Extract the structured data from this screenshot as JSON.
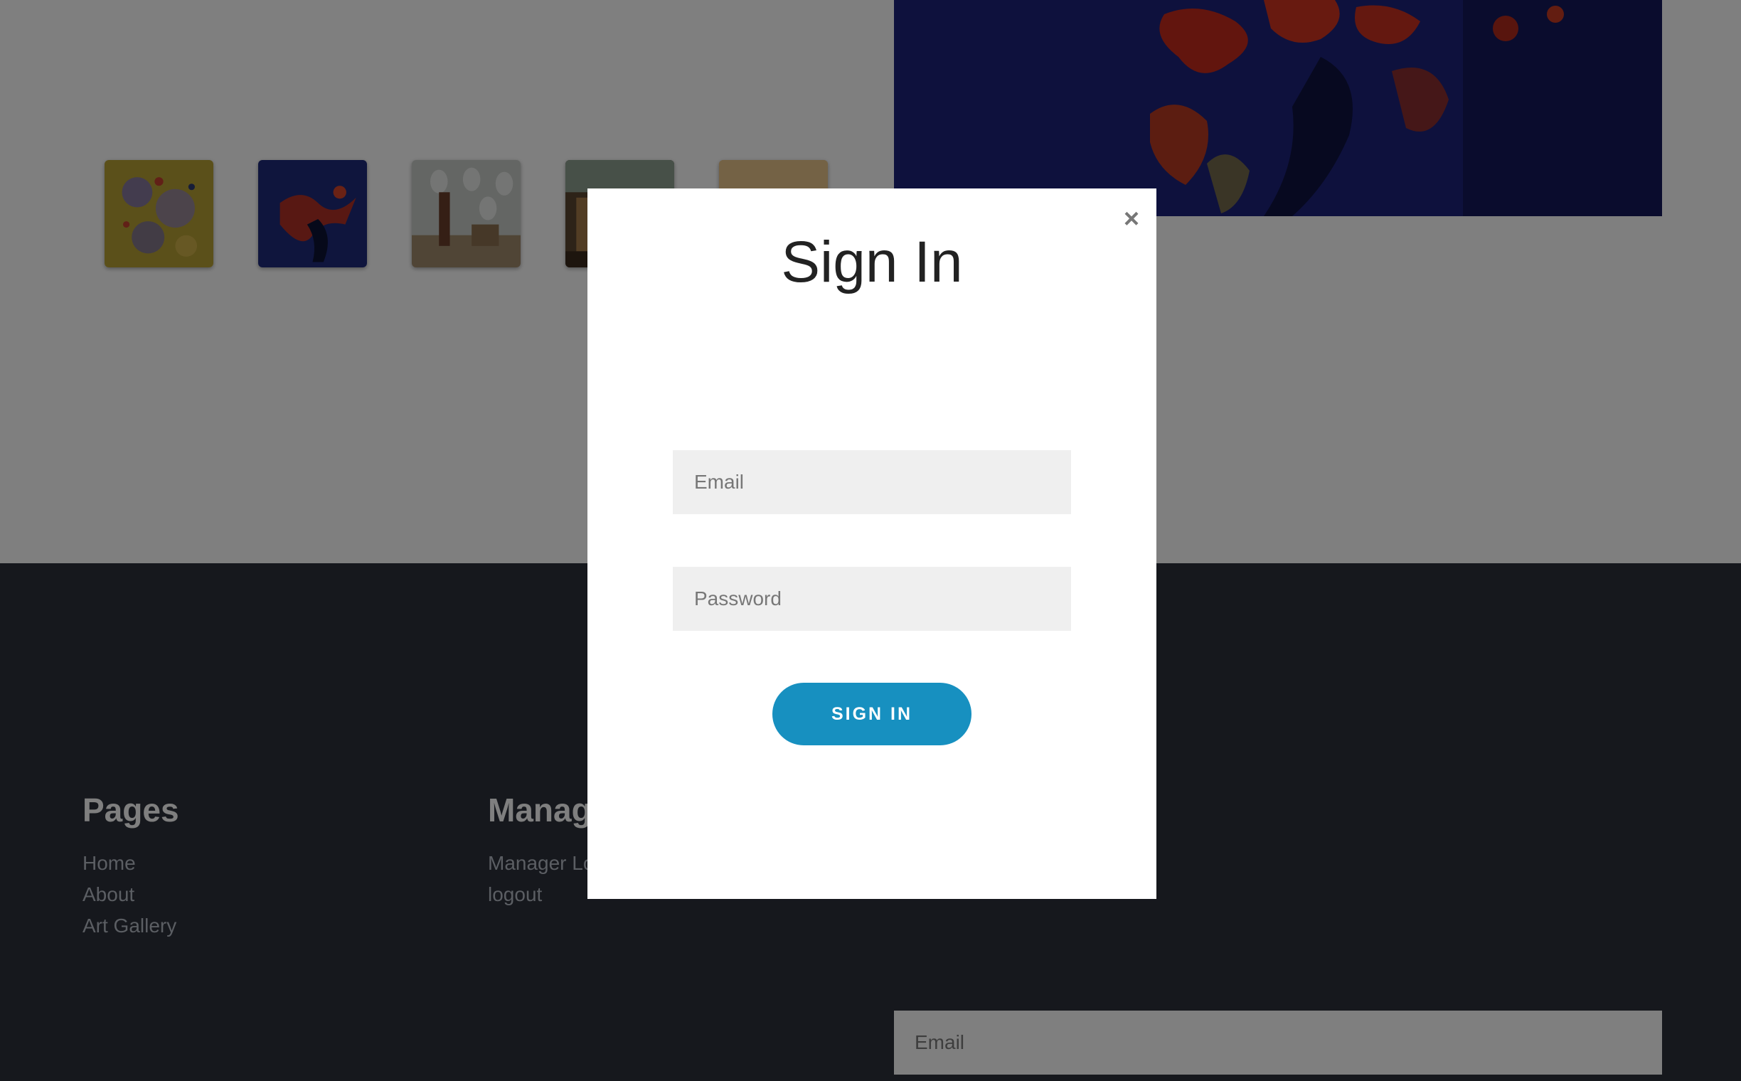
{
  "footer": {
    "columns": [
      {
        "title": "Pages",
        "links": [
          "Home",
          "About",
          "Art Gallery"
        ]
      },
      {
        "title": "Manager",
        "links": [
          "Manager Login",
          "logout"
        ]
      }
    ],
    "newsletter": {
      "email_placeholder": "Email"
    }
  },
  "modal": {
    "close_label": "×",
    "title": "Sign In",
    "email_placeholder": "Email",
    "password_placeholder": "Password",
    "submit_label": "SIGN IN"
  },
  "colors": {
    "footer_bg": "#2c303a",
    "button_accent": "#1790c0",
    "input_bg": "#efefef"
  }
}
